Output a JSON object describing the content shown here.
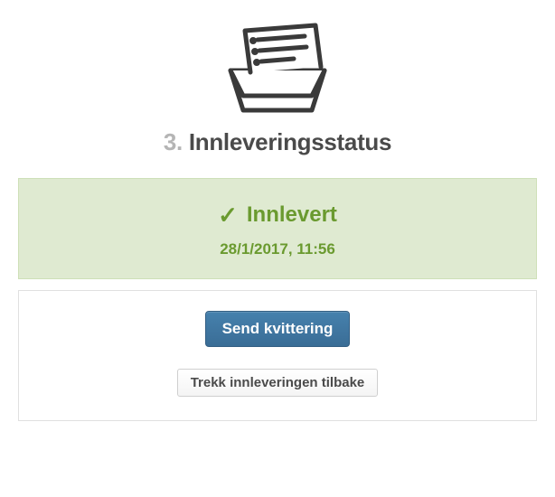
{
  "header": {
    "step_number": "3.",
    "title": "Innleveringsstatus"
  },
  "status": {
    "label": "Innlevert",
    "timestamp": "28/1/2017, 11:56"
  },
  "actions": {
    "primary_label": "Send kvittering",
    "secondary_label": "Trekk innleveringen tilbake"
  }
}
